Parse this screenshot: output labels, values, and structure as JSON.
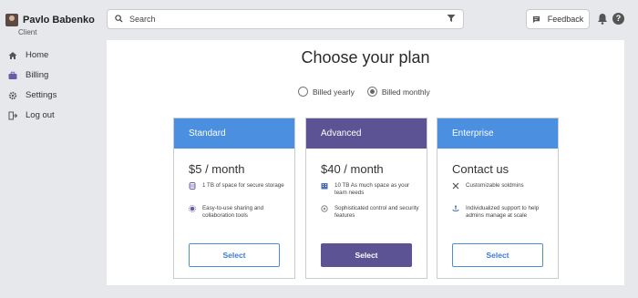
{
  "user": {
    "name": "Pavlo Babenko",
    "role": "Client"
  },
  "sidebar": {
    "items": [
      {
        "label": "Home",
        "icon": "home-icon"
      },
      {
        "label": "Billing",
        "icon": "briefcase-icon"
      },
      {
        "label": "Settings",
        "icon": "gear-icon"
      },
      {
        "label": "Log out",
        "icon": "logout-icon"
      }
    ]
  },
  "search": {
    "placeholder": "Search"
  },
  "feedback": {
    "label": "Feedback"
  },
  "help": {
    "glyph": "?"
  },
  "page": {
    "title": "Choose your plan"
  },
  "billing": {
    "yearly": "Billed yearly",
    "monthly": "Billed monthly",
    "selected": "monthly"
  },
  "colors": {
    "standard": "#4a8fe0",
    "advanced": "#5b5393",
    "enterprise": "#4a8fe0"
  },
  "plans": [
    {
      "name": "Standard",
      "price": "$5 / month",
      "features": [
        {
          "icon": "storage-icon",
          "text": "1 TB of space for secure storage"
        },
        {
          "icon": "share-icon",
          "text": "Easy-to-use sharing and collaboration tools"
        }
      ],
      "button": "Select"
    },
    {
      "name": "Advanced",
      "price": "$40 / month",
      "features": [
        {
          "icon": "building-icon",
          "text": "10 TB As much space as your team needs"
        },
        {
          "icon": "control-icon",
          "text": "Sophisticated control and security features"
        }
      ],
      "button": "Select"
    },
    {
      "name": "Enterprise",
      "price": "Contact us",
      "features": [
        {
          "icon": "tools-icon",
          "text": "Customizable soldmins"
        },
        {
          "icon": "support-icon",
          "text": "Individualized support to help admins manage at scale"
        }
      ],
      "button": "Select"
    }
  ]
}
